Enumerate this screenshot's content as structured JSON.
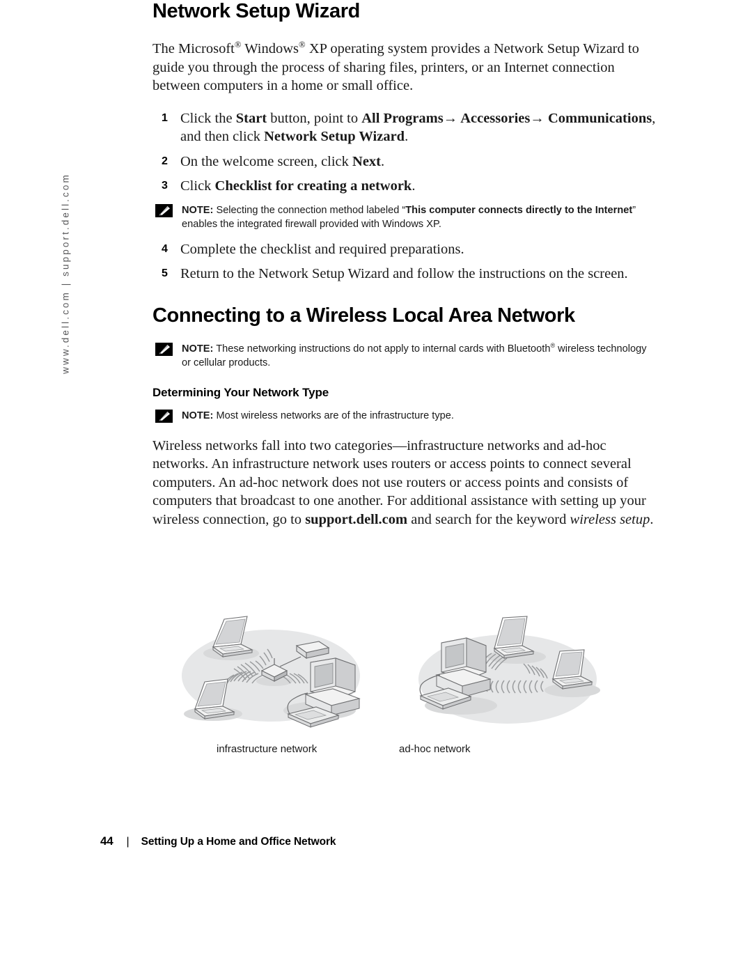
{
  "sidebar": {
    "url_text": "www.dell.com | support.dell.com"
  },
  "sections": {
    "wizard": {
      "heading": "Network Setup Wizard",
      "intro_1": "The Microsoft",
      "intro_2": " Windows",
      "intro_3": " XP operating system provides a Network Setup Wizard to guide you through the process of sharing files, printers, or an Internet connection between computers in a home or small office.",
      "reg_mark": "®",
      "steps": [
        {
          "num": "1",
          "parts": [
            {
              "t": "Click the ",
              "s": "n"
            },
            {
              "t": "Start",
              "s": "b"
            },
            {
              "t": " button, point to ",
              "s": "n"
            },
            {
              "t": "All Programs→ Accessories→ Communications",
              "s": "b"
            },
            {
              "t": ", and then click ",
              "s": "n"
            },
            {
              "t": "Network Setup Wizard",
              "s": "b"
            },
            {
              "t": ".",
              "s": "n"
            }
          ]
        },
        {
          "num": "2",
          "parts": [
            {
              "t": "On the welcome screen, click ",
              "s": "n"
            },
            {
              "t": "Next",
              "s": "b"
            },
            {
              "t": ".",
              "s": "n"
            }
          ]
        },
        {
          "num": "3",
          "parts": [
            {
              "t": "Click ",
              "s": "n"
            },
            {
              "t": "Checklist for creating a network",
              "s": "b"
            },
            {
              "t": ".",
              "s": "n"
            }
          ]
        },
        {
          "num": "4",
          "parts": [
            {
              "t": "Complete the checklist and required preparations.",
              "s": "n"
            }
          ]
        },
        {
          "num": "5",
          "parts": [
            {
              "t": "Return to the Network Setup Wizard and follow the instructions on the screen.",
              "s": "n"
            }
          ]
        }
      ],
      "note": {
        "label": "NOTE:",
        "text_1": " Selecting the connection method labeled “",
        "bold_1": "This computer connects directly to the Internet",
        "text_2": "” enables the integrated firewall provided with Windows XP."
      }
    },
    "wireless": {
      "heading": "Connecting to a Wireless Local Area Network",
      "note": {
        "label": "NOTE:",
        "text_1": " These networking instructions do not apply to internal cards with Bluetooth",
        "reg_mark": "®",
        "text_2": " wireless technology or cellular products."
      },
      "subheading": "Determining Your Network Type",
      "note2": {
        "label": "NOTE:",
        "text": " Most wireless networks are of the infrastructure type."
      },
      "body_1": "Wireless networks fall into two categories—infrastructure networks and ad-hoc networks. An infrastructure network uses routers or access points to connect several computers. An ad-hoc network does not use routers or access points and consists of computers that broadcast to one another. For additional assistance with setting up your wireless connection, go to ",
      "body_bold": "support.dell.com",
      "body_2": " and search for the keyword ",
      "body_italic": "wireless setup",
      "body_3": "."
    }
  },
  "figures": [
    {
      "caption": "infrastructure network"
    },
    {
      "caption": "ad-hoc network"
    }
  ],
  "footer": {
    "page_number": "44",
    "separator": "|",
    "title": "Setting Up a Home and Office Network"
  },
  "colors": {
    "ellipse_gray": "#e6e7e8",
    "device_light": "#f2f2f2",
    "device_mid": "#d9dadb",
    "device_dark": "#a9abad",
    "outline": "#6d6e70",
    "text_gray": "#58585a"
  }
}
